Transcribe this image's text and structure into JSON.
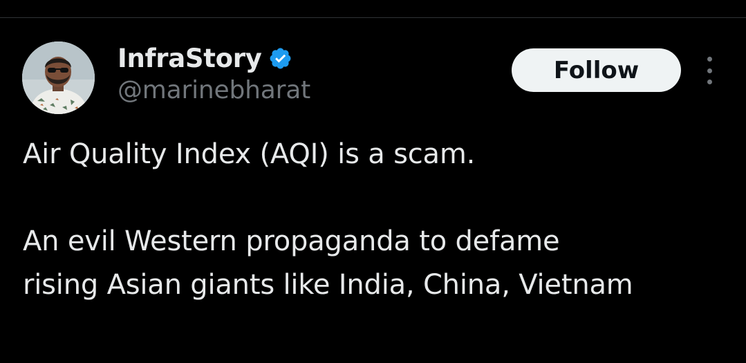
{
  "tweet": {
    "author": {
      "display_name": "InfraStory",
      "handle": "@marinebharat",
      "verified": true,
      "verified_color": "#1d9bf0",
      "avatar_icon": "profile-photo"
    },
    "follow_label": "Follow",
    "more_icon": "more-vertical-icon",
    "text_lines": {
      "line1": "Air Quality Index (AQI) is a scam.",
      "line2": "An evil Western propaganda to defame",
      "line3": "rising Asian giants like India, China, Vietnam"
    }
  },
  "colors": {
    "background": "#000000",
    "primary_text": "#e7e9ea",
    "secondary_text": "#71767b",
    "follow_bg": "#eff3f4",
    "follow_text": "#0f1419"
  }
}
